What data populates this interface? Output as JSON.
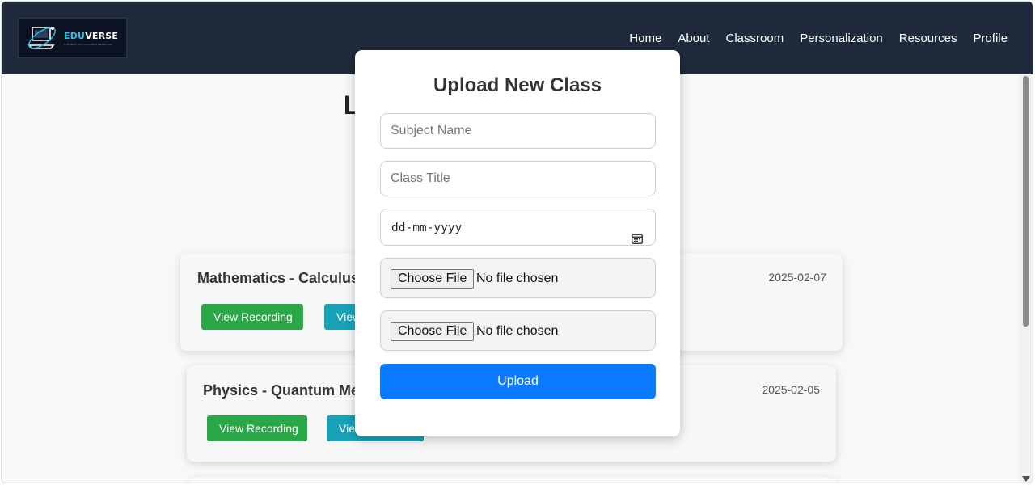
{
  "header": {
    "logo": {
      "name_part1": "EDU",
      "name_part2": "VERSE",
      "tagline": "A WORLD OF LIMITLESS LEARNING"
    },
    "nav": [
      "Home",
      "About",
      "Classroom",
      "Personalization",
      "Resources",
      "Profile"
    ]
  },
  "main": {
    "heading": "Live and Recorded Classes",
    "classes": [
      {
        "title": "Mathematics - Calculus",
        "date": "2025-02-07",
        "recording_label": "View Recording",
        "secondary_label": "View Notes"
      },
      {
        "title": "Physics - Quantum Mechanics",
        "date": "2025-02-05",
        "recording_label": "View Recording",
        "secondary_label": "View Notes"
      }
    ]
  },
  "modal": {
    "title": "Upload New Class",
    "subject_placeholder": "Subject Name",
    "class_title_placeholder": "Class Title",
    "date_placeholder": "dd-mm-yyyy",
    "file_button_label": "Choose File",
    "file_status": "No file chosen",
    "upload_label": "Upload"
  },
  "colors": {
    "navbar": "#1f2a3c",
    "primary": "#0a7bff",
    "success": "#2aa746",
    "info": "#18a2b8"
  }
}
